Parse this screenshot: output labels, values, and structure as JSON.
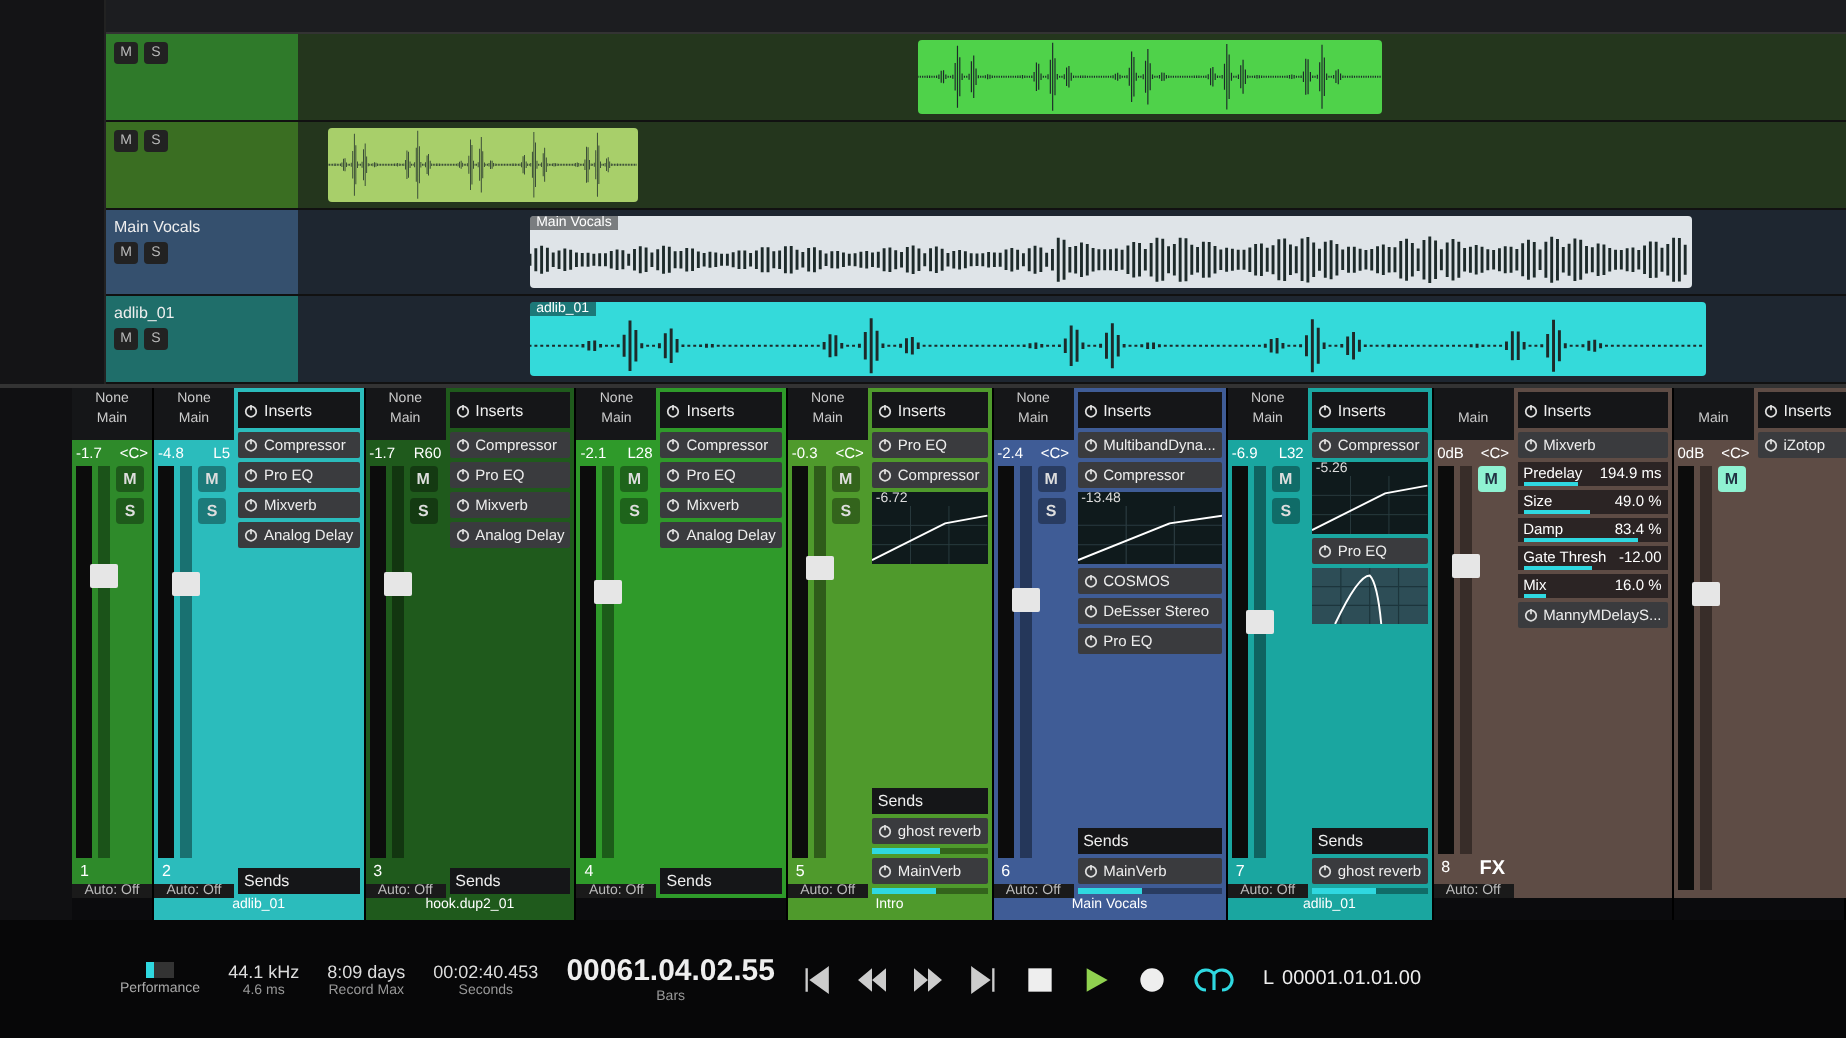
{
  "arrangement": {
    "tracks": [
      {
        "color": "#2f7a2a",
        "buttons": [
          {
            "label": "M",
            "on": false
          },
          {
            "label": "S",
            "on": false
          }
        ],
        "clip": {
          "color": "#4fd24a",
          "kind": "sparse"
        }
      },
      {
        "color": "#3a6e22",
        "buttons": [
          {
            "label": "M",
            "on": false
          },
          {
            "label": "S",
            "on": false
          }
        ],
        "clip": {
          "color": "#a8cf6a",
          "kind": "sparse"
        }
      },
      {
        "name": "Main Vocals",
        "color": "#35506e",
        "buttons": [
          {
            "label": "M",
            "on": false
          },
          {
            "label": "S",
            "on": false
          }
        ],
        "clip": {
          "label": "Main Vocals",
          "color": "#dfe4e8",
          "kind": "dense"
        }
      },
      {
        "name": "adlib_01",
        "color": "#1f6e6a",
        "buttons": [
          {
            "label": "M",
            "on": false
          },
          {
            "label": "S",
            "on": false
          }
        ],
        "clip": {
          "label": "adlib_01",
          "color": "#34dada",
          "kind": "sparse"
        }
      }
    ]
  },
  "mixer": {
    "channels": [
      {
        "color": "#2e8a2a",
        "route_in": "None",
        "route_out": "Main",
        "volume": "-1.7",
        "pan": "<C>",
        "buttons": [
          {
            "label": "M",
            "on": false
          },
          {
            "label": "S",
            "on": false
          }
        ],
        "fader": {
          "level": 0.72
        },
        "number": "1",
        "auto": "Auto: Off"
      },
      {
        "color": "#2bbcbc",
        "route_in": "None",
        "route_out": "Main",
        "volume": "-4.8",
        "pan": "L5",
        "buttons": [
          {
            "label": "M",
            "on": false
          },
          {
            "label": "S",
            "on": false
          }
        ],
        "fader": {
          "level": 0.7
        },
        "number": "2",
        "auto": "Auto: Off",
        "name": "adlib_01",
        "panel": {
          "title": "Inserts",
          "rows": [
            {
              "kind": "insert",
              "name": "Compressor"
            },
            {
              "kind": "insert",
              "name": "Pro EQ"
            },
            {
              "kind": "insert",
              "name": "Mixverb"
            },
            {
              "kind": "insert",
              "name": "Analog Delay"
            },
            {
              "kind": "spacer"
            },
            {
              "kind": "sends",
              "name": "Sends"
            }
          ]
        }
      },
      {
        "color": "#1f5a1c",
        "route_in": "None",
        "route_out": "Main",
        "volume": "-1.7",
        "pan": "R60",
        "buttons": [
          {
            "label": "M",
            "on": false
          },
          {
            "label": "S",
            "on": false
          }
        ],
        "fader": {
          "level": 0.7
        },
        "number": "3",
        "auto": "Auto: Off",
        "name": "hook.dup2_01",
        "panel": {
          "title": "Inserts",
          "rows": [
            {
              "kind": "insert",
              "name": "Compressor"
            },
            {
              "kind": "insert",
              "name": "Pro EQ"
            },
            {
              "kind": "insert",
              "name": "Mixverb"
            },
            {
              "kind": "insert",
              "name": "Analog Delay"
            },
            {
              "kind": "spacer"
            },
            {
              "kind": "sends",
              "name": "Sends"
            }
          ]
        }
      },
      {
        "color": "#2f9a2a",
        "route_in": "None",
        "route_out": "Main",
        "volume": "-2.1",
        "pan": "L28",
        "buttons": [
          {
            "label": "M",
            "on": false
          },
          {
            "label": "S",
            "on": false
          }
        ],
        "fader": {
          "level": 0.68
        },
        "number": "4",
        "auto": "Auto: Off",
        "panel": {
          "title": "Inserts",
          "rows": [
            {
              "kind": "insert",
              "name": "Compressor"
            },
            {
              "kind": "insert",
              "name": "Pro EQ"
            },
            {
              "kind": "insert",
              "name": "Mixverb"
            },
            {
              "kind": "insert",
              "name": "Analog Delay"
            },
            {
              "kind": "spacer"
            },
            {
              "kind": "sends",
              "name": "Sends"
            }
          ]
        }
      },
      {
        "color": "#4f9a2c",
        "route_in": "None",
        "route_out": "Main",
        "volume": "-0.3",
        "pan": "<C>",
        "buttons": [
          {
            "label": "M",
            "on": false
          },
          {
            "label": "S",
            "on": false
          }
        ],
        "fader": {
          "level": 0.74
        },
        "number": "5",
        "auto": "Auto: Off",
        "name": "Intro",
        "panel": {
          "title": "Inserts",
          "rows": [
            {
              "kind": "insert",
              "name": "Pro EQ"
            },
            {
              "kind": "insert",
              "name": "Compressor"
            },
            {
              "kind": "comp",
              "reading": "-6.72"
            },
            {
              "kind": "spacer"
            },
            {
              "kind": "sends",
              "name": "Sends"
            },
            {
              "kind": "send",
              "name": "ghost reverb",
              "level": 0.6
            },
            {
              "kind": "send",
              "name": "MainVerb",
              "level": 0.55
            }
          ]
        }
      },
      {
        "color": "#3f5c96",
        "route_in": "None",
        "route_out": "Main",
        "volume": "-2.4",
        "pan": "<C>",
        "buttons": [
          {
            "label": "M",
            "on": false
          },
          {
            "label": "S",
            "on": false
          }
        ],
        "fader": {
          "level": 0.66
        },
        "number": "6",
        "auto": "Auto: Off",
        "name": "Main Vocals",
        "panel": {
          "title": "Inserts",
          "rows": [
            {
              "kind": "insert",
              "name": "MultibandDyna..."
            },
            {
              "kind": "insert",
              "name": "Compressor"
            },
            {
              "kind": "comp",
              "reading": "-13.48"
            },
            {
              "kind": "insert",
              "name": "COSMOS"
            },
            {
              "kind": "insert",
              "name": "DeEsser Stereo"
            },
            {
              "kind": "insert",
              "name": "Pro EQ"
            },
            {
              "kind": "spacer"
            },
            {
              "kind": "sends",
              "name": "Sends"
            },
            {
              "kind": "send",
              "name": "MainVerb",
              "level": 0.45
            }
          ]
        }
      },
      {
        "color": "#1aa6a0",
        "route_in": "None",
        "route_out": "Main",
        "volume": "-6.9",
        "pan": "L32",
        "buttons": [
          {
            "label": "M",
            "on": false
          },
          {
            "label": "S",
            "on": false
          }
        ],
        "fader": {
          "level": 0.6
        },
        "number": "7",
        "auto": "Auto: Off",
        "name": "adlib_01",
        "panel": {
          "title": "Inserts",
          "rows": [
            {
              "kind": "insert",
              "name": "Compressor"
            },
            {
              "kind": "comp",
              "reading": "-5.26"
            },
            {
              "kind": "insert",
              "name": "Pro EQ"
            },
            {
              "kind": "eq"
            },
            {
              "kind": "spacer"
            },
            {
              "kind": "sends",
              "name": "Sends"
            },
            {
              "kind": "send",
              "name": "ghost reverb",
              "level": 0.55
            }
          ]
        }
      },
      {
        "color": "#5e4c45",
        "route_out": "Main",
        "volume": "0dB",
        "pan": "<C>",
        "buttons": [
          {
            "label": "M",
            "on": true
          }
        ],
        "fader": {
          "level": 0.74
        },
        "number": "8",
        "type_label": "FX",
        "auto": "Auto: Off",
        "panel": {
          "title": "Inserts",
          "rows": [
            {
              "kind": "insert",
              "name": "Mixverb"
            },
            {
              "kind": "param",
              "name": "Predelay",
              "value": "194.9 ms",
              "level": 0.4
            },
            {
              "kind": "param",
              "name": "Size",
              "value": "49.0 %",
              "level": 0.49
            },
            {
              "kind": "param",
              "name": "Damp",
              "value": "83.4 %",
              "level": 0.83
            },
            {
              "kind": "param",
              "name": "Gate Thresh",
              "value": "-12.00",
              "level": 0.5
            },
            {
              "kind": "param",
              "name": "Mix",
              "value": "16.0 %",
              "level": 0.16
            },
            {
              "kind": "insert",
              "name": "MannyMDelayS..."
            },
            {
              "kind": "spacer"
            }
          ]
        }
      },
      {
        "color": "#5e4c45",
        "route_out": "Main",
        "volume": "0dB",
        "pan": "<C>",
        "buttons": [
          {
            "label": "M",
            "on": true
          }
        ],
        "fader": {
          "level": 0.7
        },
        "panel": {
          "title": "Inserts",
          "rows": [
            {
              "kind": "insert",
              "name": "iZotop"
            },
            {
              "kind": "spacer"
            }
          ]
        }
      }
    ]
  },
  "transport": {
    "status_label": "Performance",
    "readouts": [
      {
        "value": "44.1 kHz",
        "caption": "4.6 ms"
      },
      {
        "value": "8:09 days",
        "caption": "Record Max"
      },
      {
        "value": "00:02:40.453",
        "caption": "Seconds"
      },
      {
        "value": "00061.04.02.55",
        "caption": "Bars",
        "kind": "big"
      }
    ],
    "loop": {
      "label": "L",
      "value": "00001.01.01.00"
    },
    "loop_on": true
  }
}
